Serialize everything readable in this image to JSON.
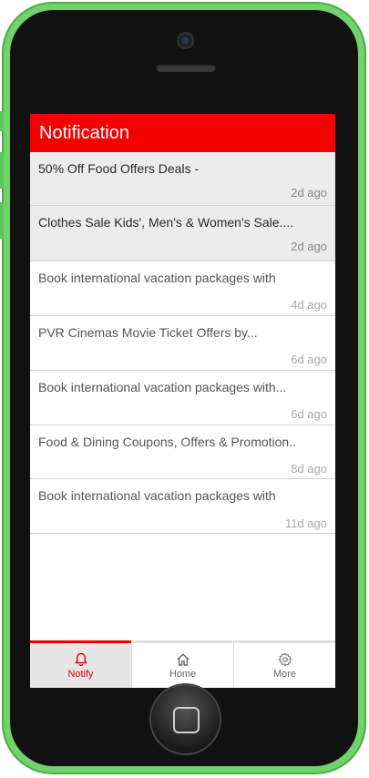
{
  "header": {
    "title": "Notification"
  },
  "notifications": [
    {
      "title": "50% Off Food Offers Deals -",
      "time": "2d ago",
      "unread": true
    },
    {
      "title": "Clothes Sale Kids', Men's & Women's Sale....",
      "time": "2d ago",
      "unread": true
    },
    {
      "title": "Book international vacation packages with",
      "time": "4d ago",
      "unread": false
    },
    {
      "title": "PVR Cinemas Movie Ticket Offers by...",
      "time": "6d ago",
      "unread": false
    },
    {
      "title": "Book international vacation packages with...",
      "time": "6d ago",
      "unread": false
    },
    {
      "title": "Food & Dining Coupons, Offers & Promotion..",
      "time": "8d ago",
      "unread": false
    },
    {
      "title": "Book international vacation packages with",
      "time": "11d ago",
      "unread": false
    }
  ],
  "tabs": [
    {
      "label": "Notify",
      "icon": "bell-icon",
      "active": true
    },
    {
      "label": "Home",
      "icon": "home-icon",
      "active": false
    },
    {
      "label": "More",
      "icon": "gear-icon",
      "active": false
    }
  ],
  "colors": {
    "accent": "#f40000",
    "phone": "#6fd26b"
  }
}
